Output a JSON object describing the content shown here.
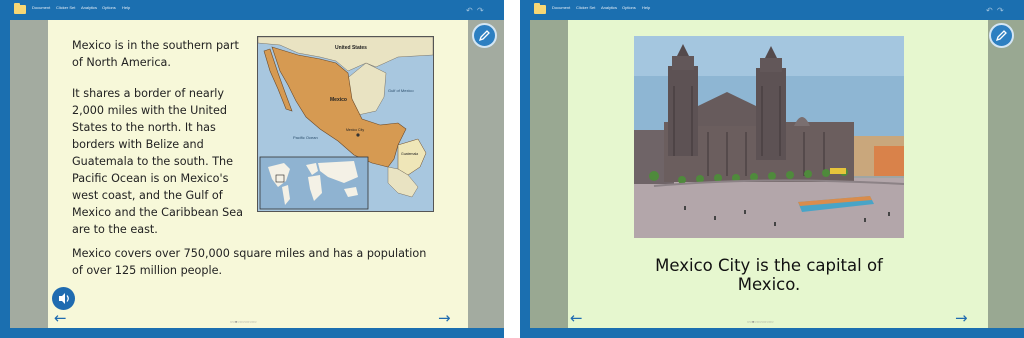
{
  "menu": {
    "document": "Document",
    "clicker_set": "Clicker Set",
    "analytics": "Analytics",
    "options": "Options",
    "help": "Help"
  },
  "left_page": {
    "paragraph_1": "Mexico is in the southern part of North America.",
    "paragraph_2": "It shares a border of nearly 2,000 miles with the United States to the north. It has borders with Belize and Guatemala to the south. The Pacific Ocean is on Mexico's west coast, and the Gulf of Mexico and the Caribbean Sea are to the east.",
    "paragraph_3": "Mexico covers over 750,000 square miles and has a population of over 125 million people.",
    "map_labels": {
      "united_states": "United States",
      "mexico": "Mexico",
      "gulf": "Gulf of Mexico",
      "pacific": "Pacific Ocean",
      "city": "Mexico City",
      "guatemala": "Guatemala"
    }
  },
  "right_page": {
    "caption": "Mexico City is the capital of Mexico."
  },
  "icons": {
    "folder": "folder-icon",
    "undo": "undo-icon",
    "redo": "redo-icon",
    "pencil": "pencil-icon",
    "speaker": "speaker-icon",
    "back": "arrow-left-icon",
    "forward": "arrow-right-icon"
  },
  "glyphs": {
    "undo": "↶",
    "redo": "↷",
    "back": "←",
    "forward": "→",
    "dots": "○○●○○○○○○○○"
  },
  "colors": {
    "frame": "#1b6fb0",
    "left_page_bg": "#f7f8d9",
    "right_page_bg": "#e6f7cf",
    "accent_button": "#2d7fc1"
  }
}
